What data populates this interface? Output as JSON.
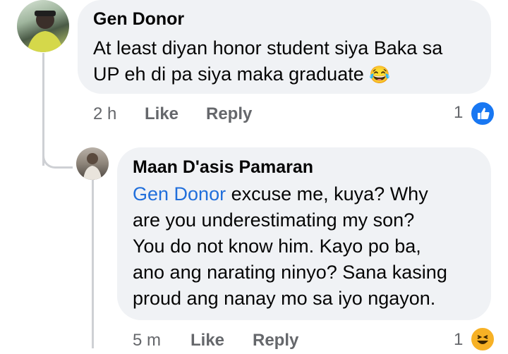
{
  "comments": [
    {
      "author": "Gen Donor",
      "text": "At least diyan honor student siya Baka sa",
      "text_line2": "UP eh di pa siya maka graduate",
      "emoji": "😂",
      "time": "2 h",
      "like_label": "Like",
      "reply_label": "Reply",
      "reaction_count": "1",
      "reaction_icon": "like-thumb-icon",
      "colors": {
        "reaction": "#1877f2"
      }
    },
    {
      "author": "Maan D'asis Pamaran",
      "mention": "Gen Donor",
      "text_lines": [
        " excuse me, kuya? Why",
        "are you underestimating my son?",
        "You do not know him. Kayo po ba,",
        "ano ang narating ninyo? Sana kasing",
        "proud ang nanay mo sa iyo ngayon."
      ],
      "time": "5 m",
      "like_label": "Like",
      "reply_label": "Reply",
      "reaction_count": "1",
      "reaction_icon": "haha-emoji-icon",
      "colors": {
        "mention": "#216fdb",
        "reaction": "#f7b125"
      }
    }
  ]
}
